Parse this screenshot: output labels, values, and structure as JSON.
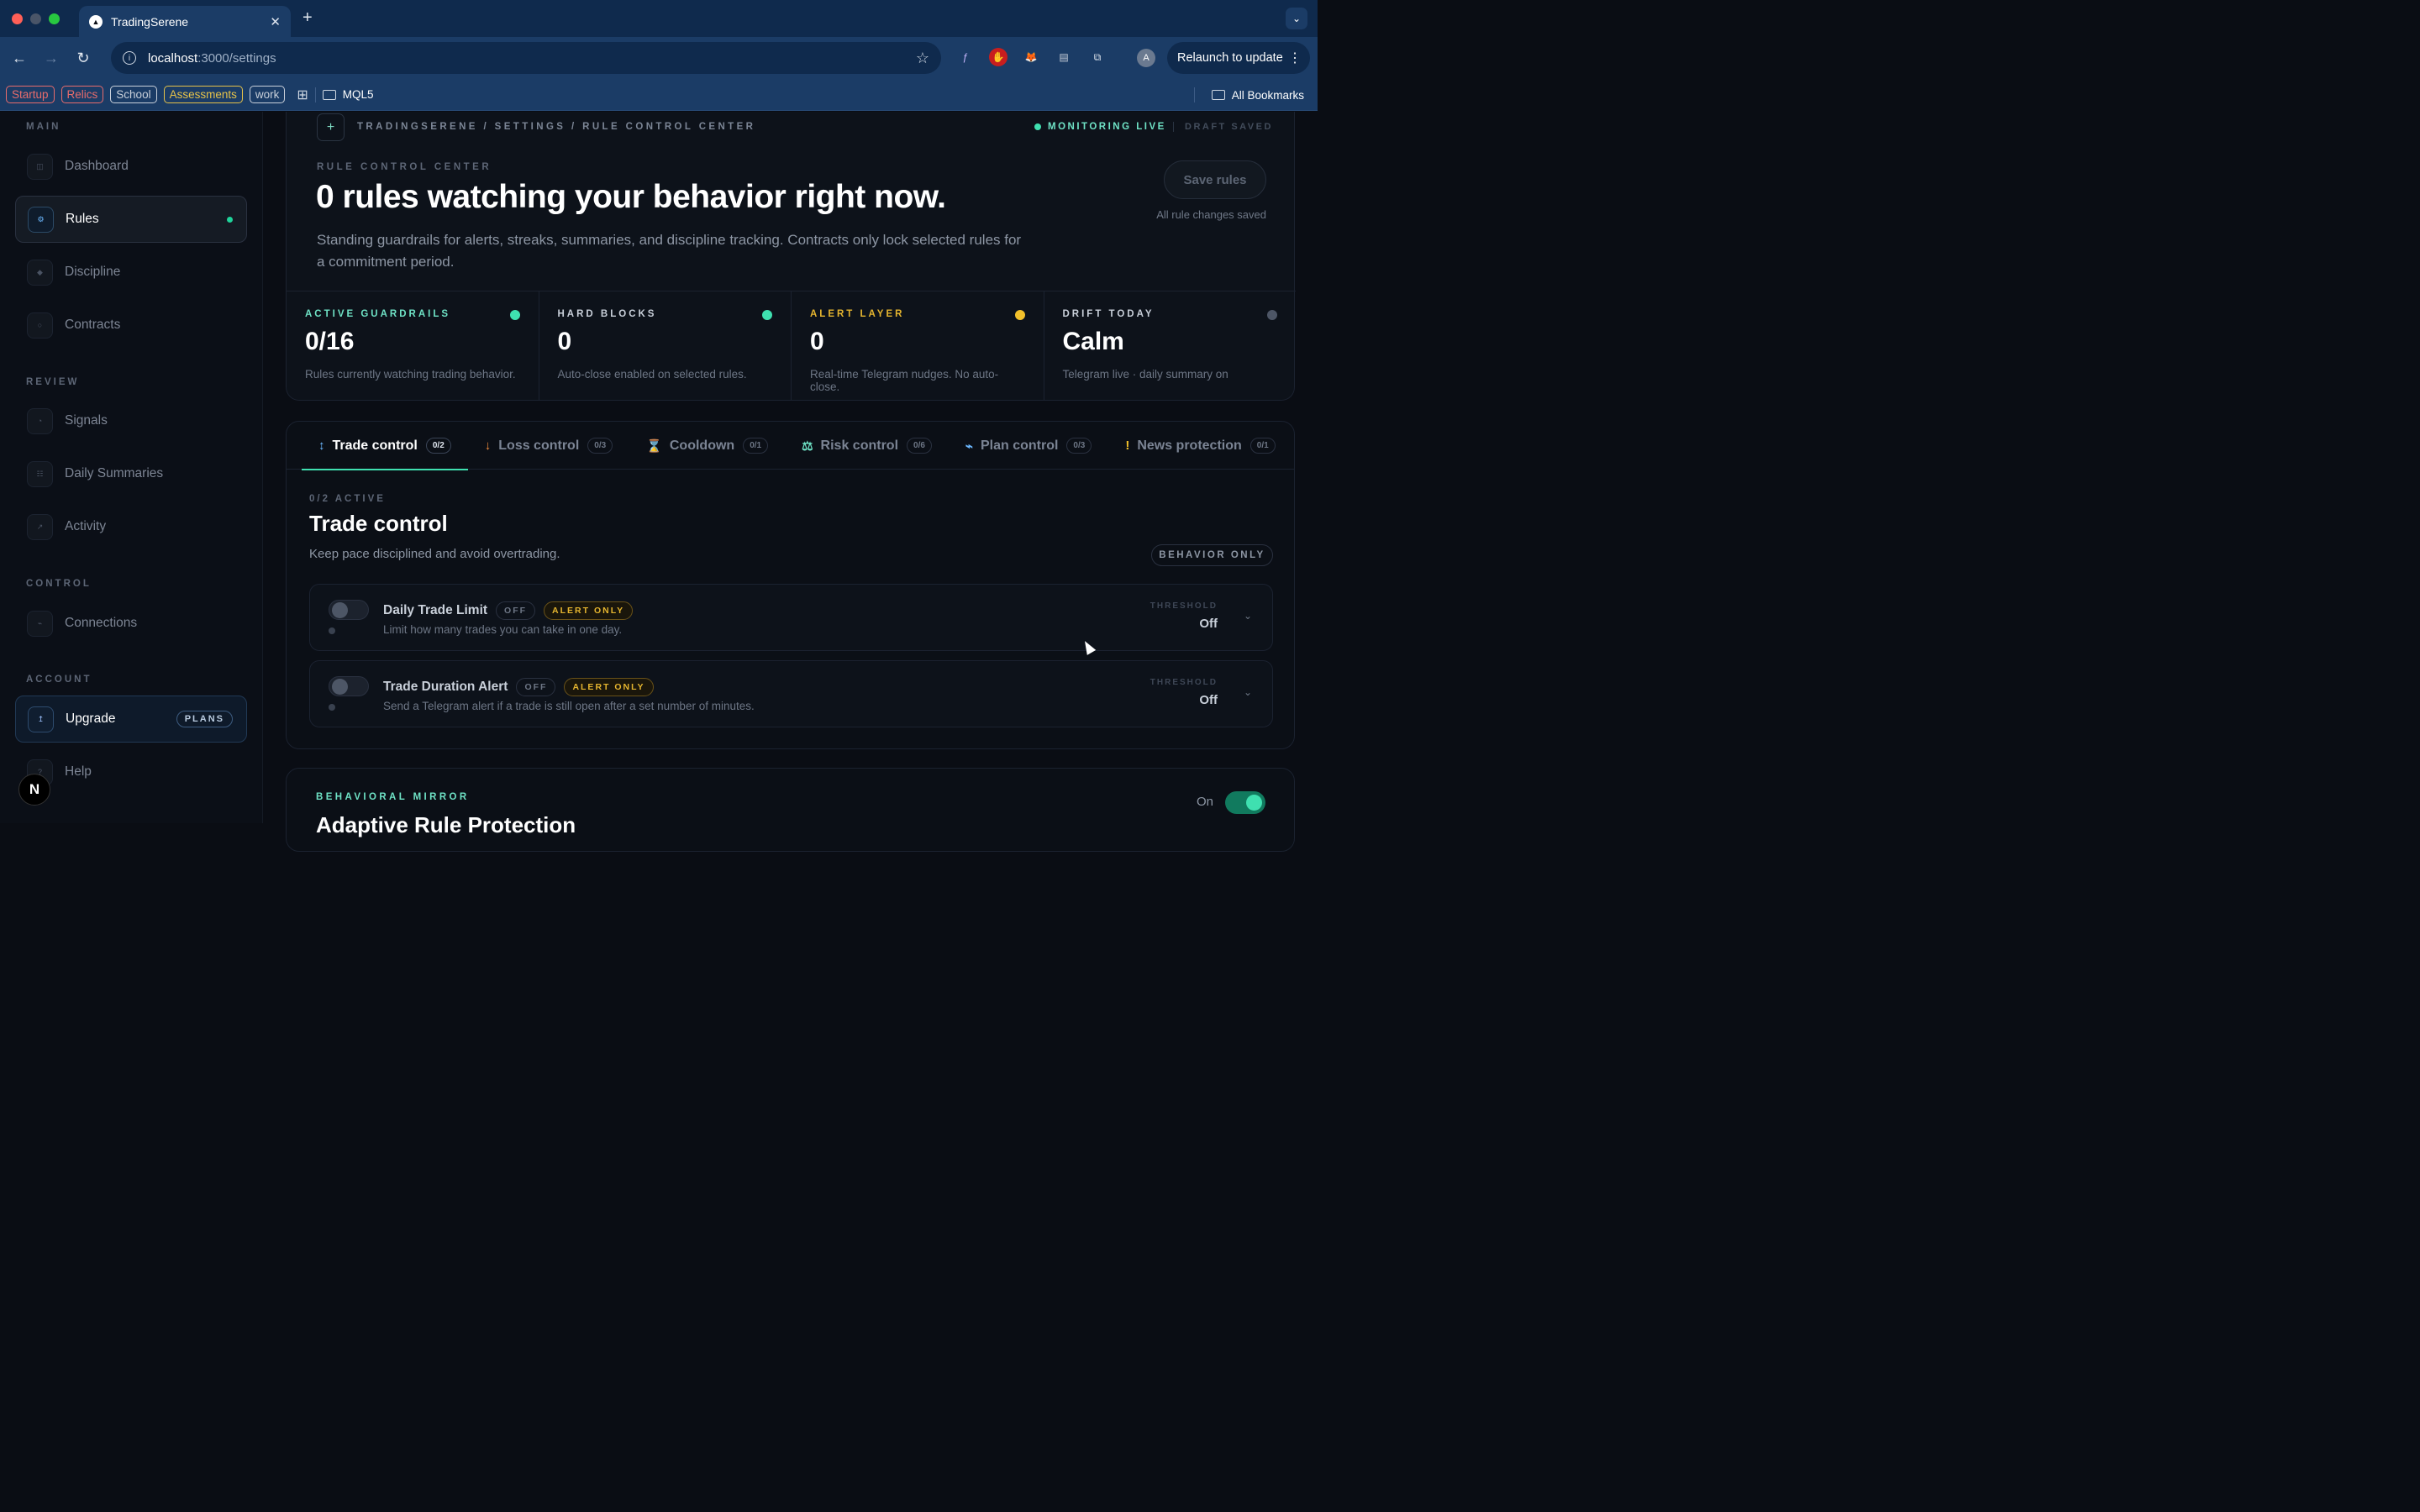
{
  "browser": {
    "tab_title": "TradingSerene",
    "url_host": "localhost",
    "url_path": ":3000/settings",
    "relaunch_label": "Relaunch to update",
    "avatar_initial": "A",
    "bookmarks": [
      {
        "label": "Startup",
        "color": "#e86c6c"
      },
      {
        "label": "Relics",
        "color": "#e86c6c"
      },
      {
        "label": "School",
        "color": "#c9d0da"
      },
      {
        "label": "Assessments",
        "color": "#e5c24a"
      },
      {
        "label": "work",
        "color": "#c9d0da"
      }
    ],
    "folder_label": "MQL5",
    "all_bookmarks_label": "All Bookmarks"
  },
  "sidebar": {
    "sections": {
      "main": "MAIN",
      "review": "REVIEW",
      "control": "CONTROL",
      "account": "ACCOUNT"
    },
    "items": {
      "dashboard": "Dashboard",
      "rules": "Rules",
      "discipline": "Discipline",
      "contracts": "Contracts",
      "signals": "Signals",
      "daily_summaries": "Daily Summaries",
      "activity": "Activity",
      "connections": "Connections",
      "upgrade": "Upgrade",
      "help": "Help"
    },
    "plans_badge": "PLANS",
    "logo_letter": "N"
  },
  "hero": {
    "breadcrumb": "TRADINGSERENE / SETTINGS / RULE CONTROL CENTER",
    "status_live": "MONITORING LIVE",
    "status_draft": "DRAFT SAVED",
    "eyebrow": "RULE CONTROL CENTER",
    "title": "0 rules watching your behavior right now.",
    "description": "Standing guardrails for alerts, streaks, summaries, and discipline tracking. Contracts only lock selected rules for a commitment period.",
    "save_label": "Save rules",
    "saved_note": "All rule changes saved"
  },
  "stats": [
    {
      "title": "ACTIVE GUARDRAILS",
      "value": "0/16",
      "sub": "Rules currently watching trading behavior.",
      "color": "#6fe3c6",
      "dot": "#3fe0b0"
    },
    {
      "title": "HARD BLOCKS",
      "value": "0",
      "sub": "Auto-close enabled on selected rules.",
      "color": "#c9d0da",
      "dot": "#3fe0b0"
    },
    {
      "title": "ALERT LAYER",
      "value": "0",
      "sub": "Real-time Telegram nudges. No auto-close.",
      "color": "#e5b52f",
      "dot": "#f2c02b"
    },
    {
      "title": "DRIFT TODAY",
      "value": "Calm",
      "sub": "Telegram live · daily summary on",
      "color": "#c9d0da",
      "dot": "#4d5666"
    }
  ],
  "tabs": [
    {
      "icon": "↕",
      "label": "Trade control",
      "count": "0/2",
      "icon_color": "#6cb8ff"
    },
    {
      "icon": "↓",
      "label": "Loss control",
      "count": "0/3",
      "icon_color": "#f08a3c"
    },
    {
      "icon": "⌛",
      "label": "Cooldown",
      "count": "0/1",
      "icon_color": "#f2c02b"
    },
    {
      "icon": "⚖",
      "label": "Risk control",
      "count": "0/6",
      "icon_color": "#6fe3c6"
    },
    {
      "icon": "⌁",
      "label": "Plan control",
      "count": "0/3",
      "icon_color": "#6cb8ff"
    },
    {
      "icon": "!",
      "label": "News protection",
      "count": "0/1",
      "icon_color": "#f2c02b"
    }
  ],
  "section": {
    "active_label": "0/2 ACTIVE",
    "title": "Trade control",
    "subtitle": "Keep pace disciplined and avoid overtrading.",
    "badge": "BEHAVIOR ONLY"
  },
  "rules": [
    {
      "name": "Daily Trade Limit",
      "state": "OFF",
      "mode": "ALERT ONLY",
      "description": "Limit how many trades you can take in one day.",
      "threshold_label": "THRESHOLD",
      "threshold_value": "Off"
    },
    {
      "name": "Trade Duration Alert",
      "state": "OFF",
      "mode": "ALERT ONLY",
      "description": "Send a Telegram alert if a trade is still open after a set number of minutes.",
      "threshold_label": "THRESHOLD",
      "threshold_value": "Off"
    }
  ],
  "mirror": {
    "eyebrow": "BEHAVIORAL MIRROR",
    "title": "Adaptive Rule Protection",
    "toggle_label": "On"
  }
}
